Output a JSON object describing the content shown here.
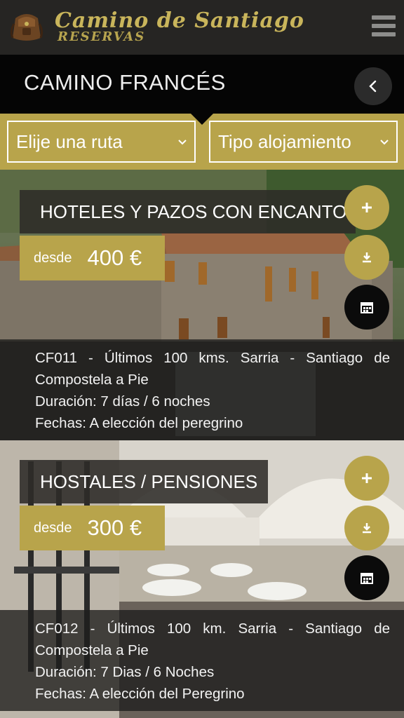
{
  "header": {
    "brand_title": "Camino de Santiago",
    "brand_subtitle": "RESERVAS",
    "menu_icon": "hamburger-menu-icon"
  },
  "section": {
    "title": "CAMINO FRANCÉS",
    "back_icon": "chevron-left-icon"
  },
  "filters": {
    "route_label": "Elije una ruta",
    "accommodation_label": "Tipo alojamiento"
  },
  "cards": [
    {
      "title": "HOTELES Y PAZOS CON ENCANTO",
      "price_prefix": "desde",
      "price": "400 €",
      "route": "CF011 - Últimos 100 kms. Sarria - Santiago de Compostela a Pie",
      "duration": "Duración: 7 días / 6 noches",
      "dates": "Fechas: A elección del peregrino"
    },
    {
      "title": "HOSTALES / PENSIONES",
      "price_prefix": "desde",
      "price": "300 €",
      "route": "CF012 - Últimos 100 km. Sarria - Santiago de Compostela a Pie",
      "duration": "Duración: 7 Dias / 6 Noches",
      "dates": "Fechas: A elección del Peregrino"
    }
  ],
  "colors": {
    "accent_gold": "#b8a44b",
    "header_bg": "#262523",
    "section_bg": "#050505"
  }
}
